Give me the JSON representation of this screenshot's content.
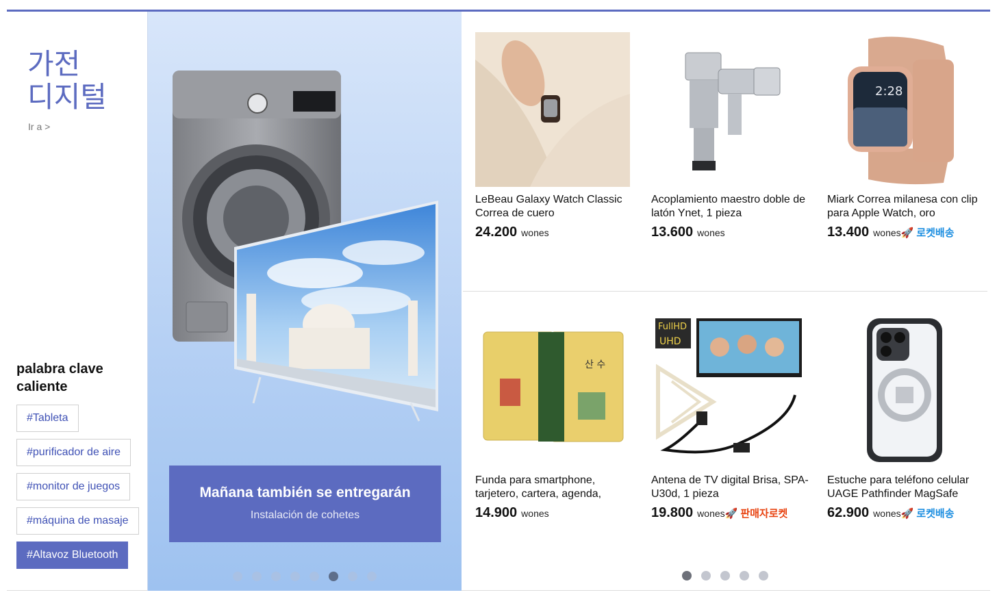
{
  "category": {
    "title_line1": "가전",
    "title_line2": "디지털",
    "goto": "Ir a >"
  },
  "hot_keywords": {
    "title": "palabra clave caliente",
    "tags": [
      "#Tableta",
      "#purificador de aire",
      "#monitor de juegos",
      "#máquina de masaje",
      "#Altavoz Bluetooth"
    ],
    "active_index": 4
  },
  "banner": {
    "title": "Mañana también se entregarán",
    "subtitle": "Instalación de cohetes",
    "dot_count": 8,
    "active_dot": 5
  },
  "products": [
    {
      "name": "LeBeau Galaxy Watch Classic Correa de cuero",
      "price": "24.200",
      "unit": "wones",
      "badge": "",
      "badge_type": ""
    },
    {
      "name": "Acoplamiento maestro doble de latón Ynet, 1 pieza",
      "price": "13.600",
      "unit": "wones",
      "badge": "",
      "badge_type": ""
    },
    {
      "name": "Miark Correa milanesa con clip para Apple Watch, oro",
      "price": "13.400",
      "unit": "wones",
      "badge": "로켓배송",
      "badge_type": "rocket"
    },
    {
      "name": "Funda para smartphone, tarjetero, cartera, agenda,",
      "price": "14.900",
      "unit": "wones",
      "badge": "",
      "badge_type": ""
    },
    {
      "name": "Antena de TV digital Brisa, SPA-U30d, 1 pieza",
      "price": "19.800",
      "unit": "wones",
      "badge": "판매자로켓",
      "badge_type": "seller"
    },
    {
      "name": "Estuche para teléfono celular UAGE Pathfinder MagSafe",
      "price": "62.900",
      "unit": "wones",
      "badge": "로켓배송",
      "badge_type": "rocket"
    }
  ],
  "product_pager": {
    "dot_count": 5,
    "active_dot": 0
  },
  "colors": {
    "accent": "#5c6bc0",
    "rocket": "#1a8de0",
    "seller_rocket": "#e8420f"
  },
  "icons": {
    "rocket": "rocket-icon"
  }
}
